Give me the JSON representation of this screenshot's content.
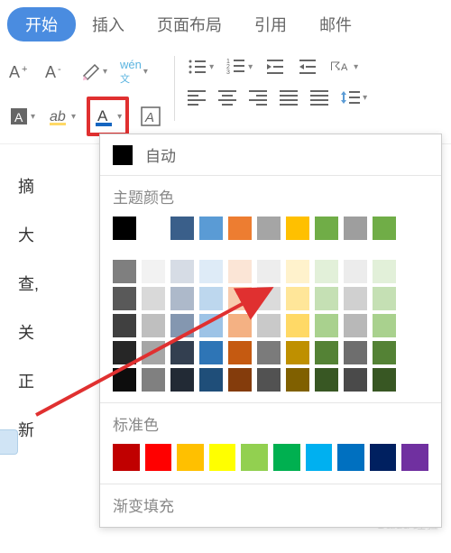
{
  "tabs": {
    "start": "开始",
    "insert": "插入",
    "layout": "页面布局",
    "reference": "引用",
    "mail": "邮件"
  },
  "popup": {
    "auto": "自动",
    "theme": "主题颜色",
    "standard": "标准色",
    "gradient": "渐变填充"
  },
  "doc_lines": [
    "摘",
    "大",
    "查,",
    "关",
    "正",
    "新"
  ],
  "colors": {
    "theme_row": [
      "#000000",
      "#ffffff",
      "#3a5f8a",
      "#5a9bd5",
      "#ed7d31",
      "#a5a5a5",
      "#ffc000",
      "#70ad47",
      "#9e9e9e",
      "#70ad47"
    ],
    "shades": [
      [
        "#7f7f7f",
        "#f2f2f2",
        "#d6dce5",
        "#deebf7",
        "#fbe5d6",
        "#ededed",
        "#fff2cc",
        "#e2f0d9",
        "#ececec",
        "#e2f0d9"
      ],
      [
        "#595959",
        "#d9d9d9",
        "#adb9ca",
        "#bdd7ee",
        "#f8cbad",
        "#dbdbdb",
        "#ffe699",
        "#c5e0b4",
        "#d0d0d0",
        "#c5e0b4"
      ],
      [
        "#404040",
        "#bfbfbf",
        "#8497b0",
        "#9dc3e6",
        "#f4b183",
        "#c9c9c9",
        "#ffd966",
        "#a9d18e",
        "#b8b8b8",
        "#a9d18e"
      ],
      [
        "#262626",
        "#a6a6a6",
        "#333f50",
        "#2e75b6",
        "#c55a11",
        "#7b7b7b",
        "#bf9000",
        "#548235",
        "#6e6e6e",
        "#548235"
      ],
      [
        "#0d0d0d",
        "#808080",
        "#222a35",
        "#1f4e79",
        "#843c0c",
        "#525252",
        "#806000",
        "#385723",
        "#4a4a4a",
        "#385723"
      ]
    ],
    "standard": [
      "#c00000",
      "#ff0000",
      "#ffc000",
      "#ffff00",
      "#92d050",
      "#00b050",
      "#00b0f0",
      "#0070c0",
      "#002060",
      "#7030a0"
    ]
  },
  "watermark": "Baidu 经验"
}
